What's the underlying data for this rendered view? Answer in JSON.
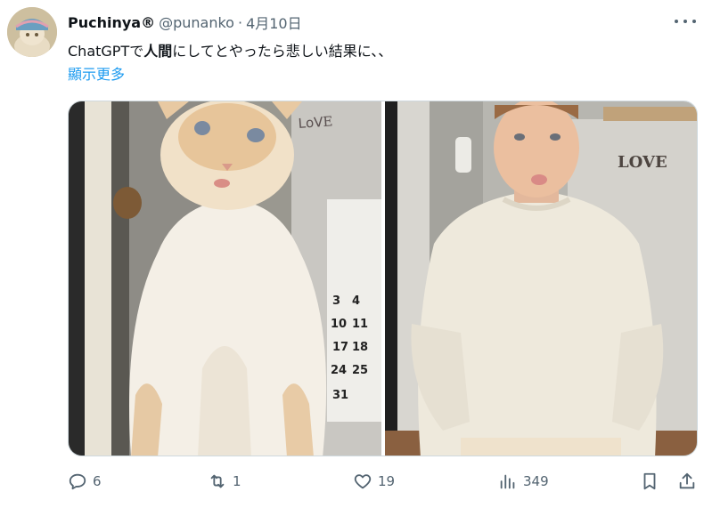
{
  "author": {
    "display_name": "Puchinya®",
    "handle": "@punanko",
    "separator": "·",
    "date": "4月10日"
  },
  "tweet": {
    "text_part1": "ChatGPTで",
    "text_bold": "人間",
    "text_part2": "にしてとやったら悲しい結果に、、",
    "show_more": "顯示更多"
  },
  "media": {
    "images": [
      {
        "subject": "cat",
        "alt": ""
      },
      {
        "subject": "human",
        "alt": ""
      }
    ],
    "wall_lettering": "LOVE",
    "calendar_numbers": [
      "3",
      "4",
      "10",
      "11",
      "17",
      "18",
      "24",
      "25",
      "31"
    ]
  },
  "actions": {
    "replies": "6",
    "retweets": "1",
    "likes": "19",
    "views": "349"
  },
  "icons": {
    "reply": "reply-icon",
    "retweet": "retweet-icon",
    "like": "heart-icon",
    "views": "views-icon",
    "bookmark": "bookmark-icon",
    "share": "share-icon",
    "more": "more-icon"
  },
  "colors": {
    "link": "#1d9bf0",
    "secondary_text": "#536471",
    "primary_text": "#0f1419"
  }
}
